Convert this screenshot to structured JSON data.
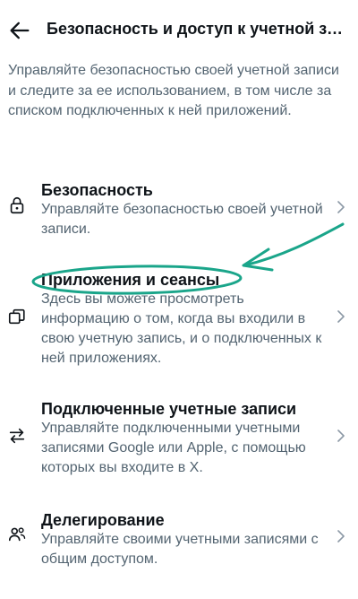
{
  "header": {
    "back_icon": "arrow-left-icon",
    "title": "Безопасность и доступ к учетной за..."
  },
  "intro": "Управляйте безопасностью своей учетной записи и следите за ее использованием, в том числе за списком подключенных к ней приложений.",
  "items": [
    {
      "icon": "lock-icon",
      "title": "Безопасность",
      "description": "Управляйте безопасностью своей учетной записи."
    },
    {
      "icon": "windows-icon",
      "title": "Приложения и сеансы",
      "description": "Здесь вы можете просмотреть информацию о том, когда вы входили в свою учетную запись, и о подключенных к ней приложениях."
    },
    {
      "icon": "arrows-swap-icon",
      "title": "Подключенные учетные записи",
      "description": "Управляйте подключенными учетными записями Google или Apple, с помощью которых вы входите в X."
    },
    {
      "icon": "people-icon",
      "title": "Делегирование",
      "description": "Управляйте своими учетными записями с общим доступом."
    }
  ],
  "colors": {
    "text_primary": "#0f1419",
    "text_secondary": "#536471",
    "annotation_green": "#1aa58a",
    "chevron": "#8b98a5"
  }
}
